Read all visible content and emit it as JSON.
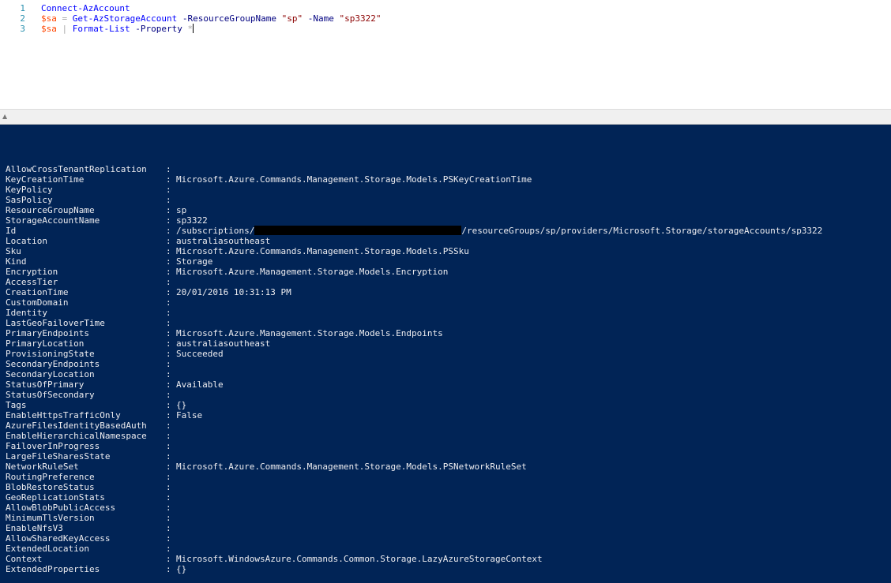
{
  "editor": {
    "lines": [
      {
        "number": "1",
        "tokens": [
          {
            "type": "cmd",
            "text": "Connect-AzAccount"
          }
        ]
      },
      {
        "number": "2",
        "tokens": [
          {
            "type": "var",
            "text": "$sa"
          },
          {
            "type": "op",
            "text": " = "
          },
          {
            "type": "cmd",
            "text": "Get-AzStorageAccount"
          },
          {
            "type": "param",
            "text": " -ResourceGroupName "
          },
          {
            "type": "str",
            "text": "\"sp\""
          },
          {
            "type": "param",
            "text": " -Name "
          },
          {
            "type": "str",
            "text": "\"sp3322\""
          }
        ]
      },
      {
        "number": "3",
        "tokens": [
          {
            "type": "var",
            "text": "$sa"
          },
          {
            "type": "op",
            "text": " | "
          },
          {
            "type": "cmd",
            "text": "Format-List"
          },
          {
            "type": "param",
            "text": " -Property "
          },
          {
            "type": "op",
            "text": "*"
          }
        ]
      }
    ]
  },
  "console": {
    "background": "#012456",
    "separator": ":",
    "rows": [
      {
        "key": "AllowCrossTenantReplication",
        "value": ""
      },
      {
        "key": "KeyCreationTime",
        "value": "Microsoft.Azure.Commands.Management.Storage.Models.PSKeyCreationTime"
      },
      {
        "key": "KeyPolicy",
        "value": ""
      },
      {
        "key": "SasPolicy",
        "value": ""
      },
      {
        "key": "ResourceGroupName",
        "value": "sp"
      },
      {
        "key": "StorageAccountName",
        "value": "sp3322"
      },
      {
        "key": "Id",
        "value": "/subscriptions/",
        "redacted": true,
        "value_after": "/resourceGroups/sp/providers/Microsoft.Storage/storageAccounts/sp3322"
      },
      {
        "key": "Location",
        "value": "australiasoutheast"
      },
      {
        "key": "Sku",
        "value": "Microsoft.Azure.Commands.Management.Storage.Models.PSSku"
      },
      {
        "key": "Kind",
        "value": "Storage"
      },
      {
        "key": "Encryption",
        "value": "Microsoft.Azure.Management.Storage.Models.Encryption"
      },
      {
        "key": "AccessTier",
        "value": ""
      },
      {
        "key": "CreationTime",
        "value": "20/01/2016 10:31:13 PM"
      },
      {
        "key": "CustomDomain",
        "value": ""
      },
      {
        "key": "Identity",
        "value": ""
      },
      {
        "key": "LastGeoFailoverTime",
        "value": ""
      },
      {
        "key": "PrimaryEndpoints",
        "value": "Microsoft.Azure.Management.Storage.Models.Endpoints"
      },
      {
        "key": "PrimaryLocation",
        "value": "australiasoutheast"
      },
      {
        "key": "ProvisioningState",
        "value": "Succeeded"
      },
      {
        "key": "SecondaryEndpoints",
        "value": ""
      },
      {
        "key": "SecondaryLocation",
        "value": ""
      },
      {
        "key": "StatusOfPrimary",
        "value": "Available"
      },
      {
        "key": "StatusOfSecondary",
        "value": ""
      },
      {
        "key": "Tags",
        "value": "{}"
      },
      {
        "key": "EnableHttpsTrafficOnly",
        "value": "False"
      },
      {
        "key": "AzureFilesIdentityBasedAuth",
        "value": ""
      },
      {
        "key": "EnableHierarchicalNamespace",
        "value": ""
      },
      {
        "key": "FailoverInProgress",
        "value": ""
      },
      {
        "key": "LargeFileSharesState",
        "value": ""
      },
      {
        "key": "NetworkRuleSet",
        "value": "Microsoft.Azure.Commands.Management.Storage.Models.PSNetworkRuleSet"
      },
      {
        "key": "RoutingPreference",
        "value": ""
      },
      {
        "key": "BlobRestoreStatus",
        "value": ""
      },
      {
        "key": "GeoReplicationStats",
        "value": ""
      },
      {
        "key": "AllowBlobPublicAccess",
        "value": ""
      },
      {
        "key": "MinimumTlsVersion",
        "value": ""
      },
      {
        "key": "EnableNfsV3",
        "value": ""
      },
      {
        "key": "AllowSharedKeyAccess",
        "value": ""
      },
      {
        "key": "ExtendedLocation",
        "value": ""
      },
      {
        "key": "Context",
        "value": "Microsoft.WindowsAzure.Commands.Common.Storage.LazyAzureStorageContext"
      },
      {
        "key": "ExtendedProperties",
        "value": "{}"
      }
    ]
  }
}
